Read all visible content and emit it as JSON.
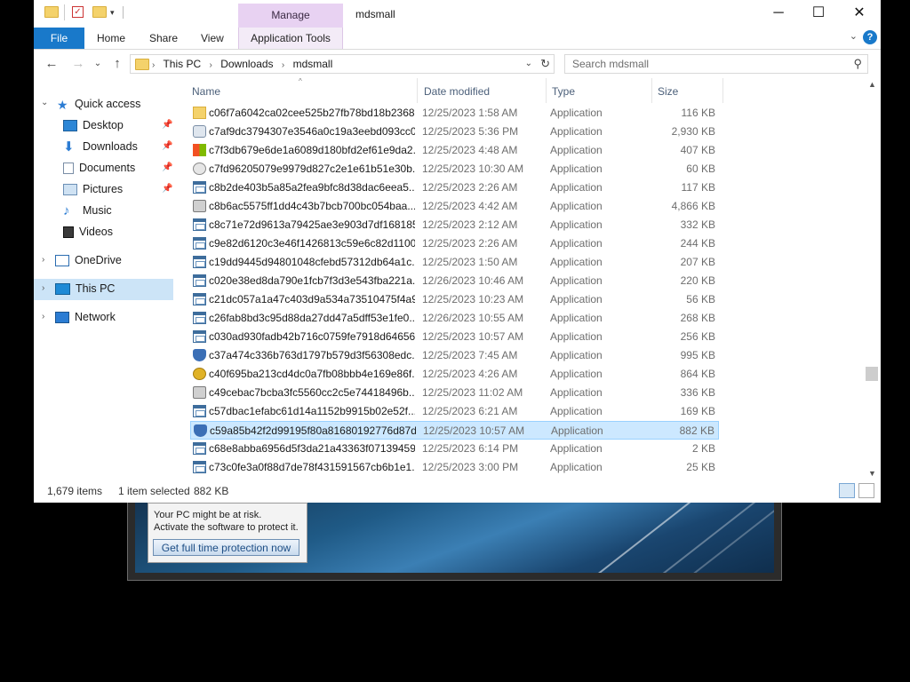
{
  "background": {
    "warning_line1": "Your PC might be at risk.",
    "warning_line2": "Activate the software to protect it.",
    "warning_button": "Get full time protection now"
  },
  "window": {
    "title": "mdsmall",
    "context_tab": "Manage",
    "minimize_glyph": "─",
    "maximize_glyph": "☐",
    "close_glyph": "✕"
  },
  "ribbon": {
    "tabs": [
      "File",
      "Home",
      "Share",
      "View",
      "Application Tools"
    ],
    "help_glyph": "?",
    "expand_glyph": "⌄"
  },
  "nav": {
    "back_glyph": "←",
    "forward_glyph": "→",
    "recent_glyph": "⌄",
    "up_glyph": "↑",
    "breadcrumb": [
      "This PC",
      "Downloads",
      "mdsmall"
    ],
    "search_placeholder": "Search mdsmall"
  },
  "sidebar": {
    "quick_access": "Quick access",
    "quick_items": [
      "Desktop",
      "Downloads",
      "Documents",
      "Pictures",
      "Music",
      "Videos"
    ],
    "onedrive": "OneDrive",
    "this_pc": "This PC",
    "network": "Network"
  },
  "columns": {
    "name": "Name",
    "date": "Date modified",
    "type": "Type",
    "size": "Size"
  },
  "files": [
    {
      "name": "c06f7a6042ca02cee525b27fb78bd18b2368...",
      "date": "12/25/2023 1:58 AM",
      "type": "Application",
      "size": "116 KB",
      "icon": "folder-icon"
    },
    {
      "name": "c7af9dc3794307e3546a0c19a3eebd093cc0...",
      "date": "12/25/2023 5:36 PM",
      "type": "Application",
      "size": "2,930 KB",
      "icon": "setup-icon"
    },
    {
      "name": "c7f3db679e6de1a6089d180bfd2ef61e9da2...",
      "date": "12/25/2023 4:48 AM",
      "type": "Application",
      "size": "407 KB",
      "icon": "windows-icon"
    },
    {
      "name": "c7fd96205079e9979d827c2e1e61b51e30b...",
      "date": "12/25/2023 10:30 AM",
      "type": "Application",
      "size": "60 KB",
      "icon": "disc-icon"
    },
    {
      "name": "c8b2de403b5a85a2fea9bfc8d38dac6eea5...",
      "date": "12/25/2023 2:26 AM",
      "type": "Application",
      "size": "117 KB",
      "icon": "app-icon"
    },
    {
      "name": "c8b6ac5575ff1dd4c43b7bcb700bc054baa...",
      "date": "12/25/2023 4:42 AM",
      "type": "Application",
      "size": "4,866 KB",
      "icon": "installer-icon"
    },
    {
      "name": "c8c71e72d9613a79425ae3e903d7df168185...",
      "date": "12/25/2023 2:12 AM",
      "type": "Application",
      "size": "332 KB",
      "icon": "app-icon"
    },
    {
      "name": "c9e82d6120c3e46f1426813c59e6c82d1100...",
      "date": "12/25/2023 2:26 AM",
      "type": "Application",
      "size": "244 KB",
      "icon": "app-icon"
    },
    {
      "name": "c19dd9445d94801048cfebd57312db64a1c...",
      "date": "12/25/2023 1:50 AM",
      "type": "Application",
      "size": "207 KB",
      "icon": "app-icon"
    },
    {
      "name": "c020e38ed8da790e1fcb7f3d3e543fba221a...",
      "date": "12/26/2023 10:46 AM",
      "type": "Application",
      "size": "220 KB",
      "icon": "app-icon"
    },
    {
      "name": "c21dc057a1a47c403d9a534a73510475f4a9...",
      "date": "12/25/2023 10:23 AM",
      "type": "Application",
      "size": "56 KB",
      "icon": "app-icon"
    },
    {
      "name": "c26fab8bd3c95d88da27dd47a5dff53e1fe0...",
      "date": "12/26/2023 10:55 AM",
      "type": "Application",
      "size": "268 KB",
      "icon": "app-icon"
    },
    {
      "name": "c030ad930fadb42b716c0759fe7918d64656...",
      "date": "12/25/2023 10:57 AM",
      "type": "Application",
      "size": "256 KB",
      "icon": "app-icon"
    },
    {
      "name": "c37a474c336b763d1797b579d3f56308edc...",
      "date": "12/25/2023 7:45 AM",
      "type": "Application",
      "size": "995 KB",
      "icon": "shield-icon"
    },
    {
      "name": "c40f695ba213cd4dc0a7fb08bbb4e169e86f...",
      "date": "12/25/2023 4:26 AM",
      "type": "Application",
      "size": "864 KB",
      "icon": "gold-shield-icon"
    },
    {
      "name": "c49cebac7bcba3fc5560cc2c5e74418496b...",
      "date": "12/25/2023 11:02 AM",
      "type": "Application",
      "size": "336 KB",
      "icon": "installer-icon"
    },
    {
      "name": "c57dbac1efabc61d14a1152b9915b02e52f...",
      "date": "12/25/2023 6:21 AM",
      "type": "Application",
      "size": "169 KB",
      "icon": "app-icon"
    },
    {
      "name": "c59a85b42f2d99195f80a81680192776d87d...",
      "date": "12/25/2023 10:57 AM",
      "type": "Application",
      "size": "882 KB",
      "icon": "shield-icon",
      "selected": true
    },
    {
      "name": "c68e8abba6956d5f3da21a43363f07139459...",
      "date": "12/25/2023 6:14 PM",
      "type": "Application",
      "size": "2 KB",
      "icon": "app-icon"
    },
    {
      "name": "c73c0fe3a0f88d7de78f431591567cb6b1e1...",
      "date": "12/25/2023 3:00 PM",
      "type": "Application",
      "size": "25 KB",
      "icon": "app-icon"
    }
  ],
  "status": {
    "item_count": "1,679 items",
    "selection": "1 item selected",
    "selection_size": "882 KB"
  }
}
